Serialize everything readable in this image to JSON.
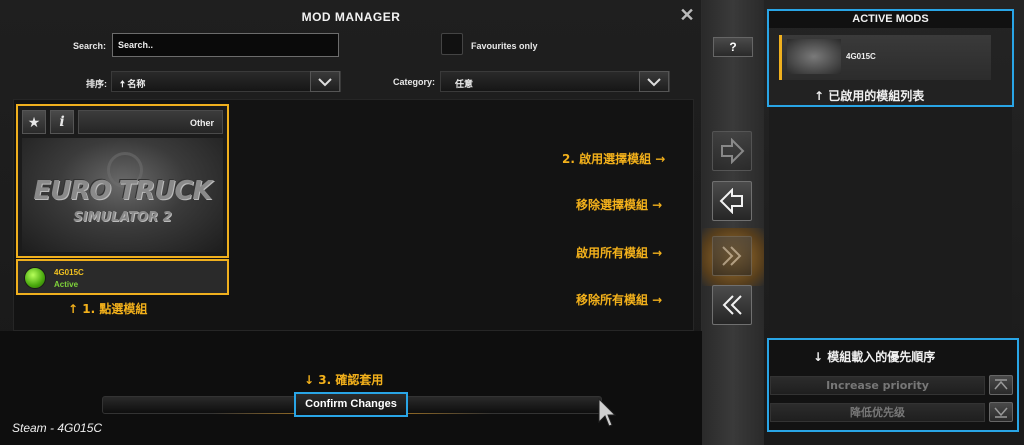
{
  "main": {
    "title": "MOD MANAGER",
    "close_glyph": "✕",
    "search_label": "Search:",
    "search_value": "Search..",
    "favourites_label": "Favourites only",
    "sort_label": "排序:",
    "sort_value": "🠅 名称",
    "category_label": "Category:",
    "category_value": "任意"
  },
  "mod_card": {
    "category": "Other",
    "logo_title": "EURO TRUCK",
    "logo_subtitle": "SIMULATOR 2",
    "name": "4G015C",
    "status": "Active"
  },
  "annotations": {
    "select_mod": "↑ 1. 點選模組",
    "enable_selected": "2. 啟用選擇模組 →",
    "remove_selected": "移除選擇模組 →",
    "enable_all": "啟用所有模組 →",
    "remove_all": "移除所有模組 →",
    "confirm": "↓ 3. 確認套用",
    "active_list": "↑ 已啟用的模組列表",
    "load_order": "↓ 模組載入的優先順序"
  },
  "footer": {
    "confirm_label": "Confirm Changes",
    "steam_label": "Steam - 4G015C"
  },
  "middle": {
    "help_label": "?"
  },
  "active_mods": {
    "title": "ACTIVE MODS",
    "items": [
      {
        "name": "4G015C"
      }
    ]
  },
  "priority": {
    "increase_label": "Increase priority",
    "decrease_label": "降低优先级"
  },
  "colors": {
    "highlight_orange": "#f0b01e",
    "annotation_blue": "#29a5e6",
    "active_green": "#7fd23a"
  },
  "icons": [
    "close-icon",
    "star-icon",
    "info-icon",
    "arrow-right-icon",
    "arrow-left-icon",
    "double-arrow-right-icon",
    "double-arrow-left-icon",
    "chevron-down-icon",
    "arrow-up-icon",
    "arrow-down-icon",
    "cursor-icon"
  ]
}
